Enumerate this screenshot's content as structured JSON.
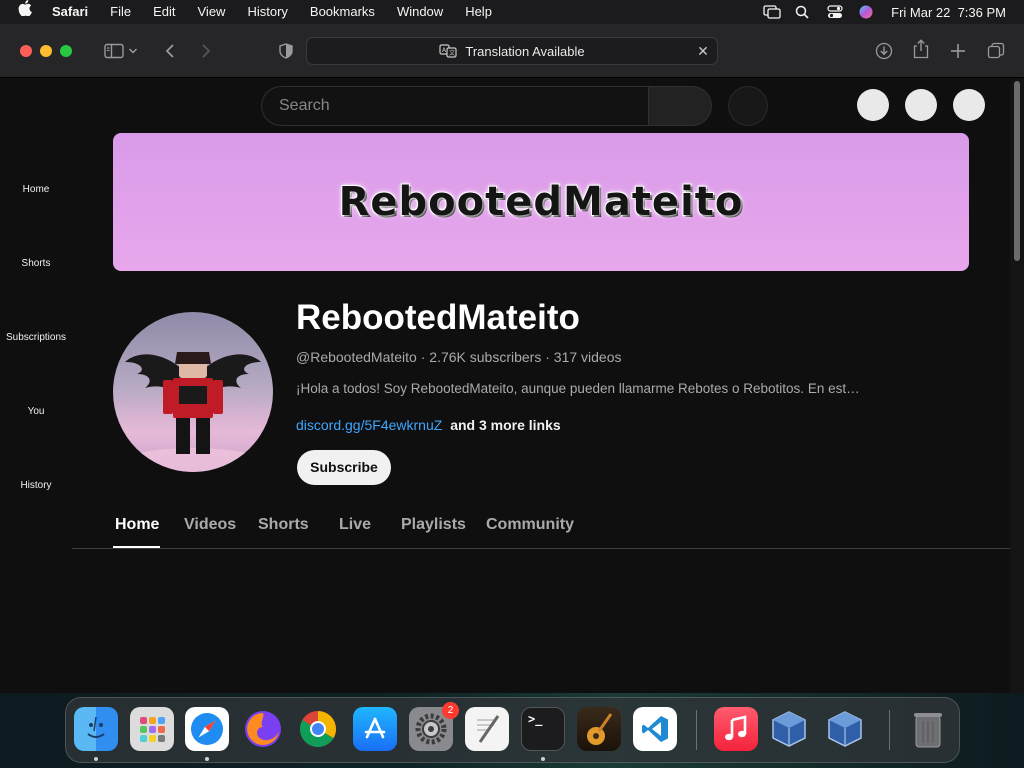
{
  "menubar": {
    "app_name": "Safari",
    "items": [
      "File",
      "Edit",
      "View",
      "History",
      "Bookmarks",
      "Window",
      "Help"
    ],
    "datetime": "Fri Mar 22  7:36 PM"
  },
  "toolbar": {
    "address_text": "Translation Available"
  },
  "youtube": {
    "search_placeholder": "Search",
    "nav": [
      "Home",
      "Shorts",
      "Subscriptions",
      "You",
      "History"
    ],
    "banner_text": "RebootedMateito",
    "channel_name": "RebootedMateito",
    "channel_meta": "@RebootedMateito · 2.76K subscribers · 317 videos",
    "description": "¡Hola a todos! Soy RebootedMateito, aunque pueden llamarme Rebotes o Rebotitos. En est…",
    "link_text": "discord.gg/5F4ewkrnuZ",
    "more_links": "and 3 more links",
    "subscribe_label": "Subscribe",
    "tabs": [
      "Home",
      "Videos",
      "Shorts",
      "Live",
      "Playlists",
      "Community"
    ],
    "active_tab": "Home"
  },
  "dock": {
    "apps": [
      "Finder",
      "Launchpad",
      "Safari",
      "Firefox",
      "Chrome",
      "App Store",
      "System Settings",
      "TextEdit",
      "Terminal",
      "GarageBand",
      "Visual Studio Code",
      "Music",
      "VirtualBox",
      "VirtualBox VM",
      "Trash"
    ],
    "settings_badge": "2"
  },
  "colors": {
    "page_bg": "#0f0f0f",
    "banner": "#e0a0ec",
    "link": "#3ea6ff",
    "close_red": "#ff5f57",
    "minimize_yellow": "#febc2e",
    "zoom_green": "#28c840"
  }
}
